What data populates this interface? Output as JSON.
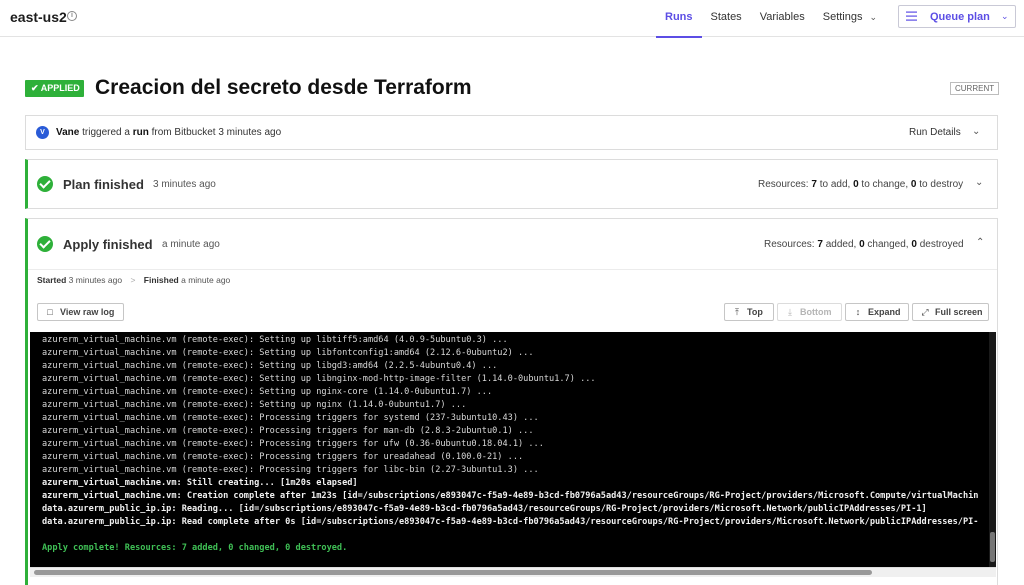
{
  "workspace": {
    "name": "east-us2"
  },
  "nav": {
    "items": [
      {
        "label": "Runs",
        "active": true
      },
      {
        "label": "States",
        "active": false
      },
      {
        "label": "Variables",
        "active": false
      },
      {
        "label": "Settings",
        "active": false
      }
    ],
    "queue_plan_label": "Queue plan"
  },
  "run": {
    "status_badge": "APPLIED",
    "title": "Creacion del secreto desde Terraform",
    "current_tag": "CURRENT",
    "trigger": {
      "avatar_letter": "V",
      "user": "Vane",
      "text_mid": "triggered a",
      "run_word": "run",
      "text_end": "from Bitbucket 3 minutes ago"
    },
    "run_details_label": "Run Details"
  },
  "plan": {
    "title": "Plan finished",
    "time": "3 minutes ago",
    "res_prefix": "Resources:",
    "add": "7",
    "add_label": "to add,",
    "change": "0",
    "change_label": "to change,",
    "destroy": "0",
    "destroy_label": "to destroy"
  },
  "apply": {
    "title": "Apply finished",
    "time": "a minute ago",
    "res_prefix": "Resources:",
    "added": "7",
    "added_label": "added,",
    "changed": "0",
    "changed_label": "changed,",
    "destroyed": "0",
    "destroyed_label": "destroyed",
    "started_label": "Started",
    "started_time": "3 minutes ago",
    "finished_label": "Finished",
    "finished_time": "a minute ago",
    "separator": ">",
    "buttons": {
      "view_raw_log": "View raw log",
      "top": "Top",
      "bottom": "Bottom",
      "expand": "Expand",
      "full_screen": "Full screen"
    }
  },
  "log_lines": [
    {
      "text": "azurerm_virtual_machine.vm (remote-exec): Setting up libtiff5:amd64 (4.0.9-5ubuntu0.3) ...",
      "style": "normal"
    },
    {
      "text": "azurerm_virtual_machine.vm (remote-exec): Setting up libfontconfig1:amd64 (2.12.6-0ubuntu2) ...",
      "style": "normal"
    },
    {
      "text": "azurerm_virtual_machine.vm (remote-exec): Setting up libgd3:amd64 (2.2.5-4ubuntu0.4) ...",
      "style": "normal"
    },
    {
      "text": "azurerm_virtual_machine.vm (remote-exec): Setting up libnginx-mod-http-image-filter (1.14.0-0ubuntu1.7) ...",
      "style": "normal"
    },
    {
      "text": "azurerm_virtual_machine.vm (remote-exec): Setting up nginx-core (1.14.0-0ubuntu1.7) ...",
      "style": "normal"
    },
    {
      "text": "azurerm_virtual_machine.vm (remote-exec): Setting up nginx (1.14.0-0ubuntu1.7) ...",
      "style": "normal"
    },
    {
      "text": "azurerm_virtual_machine.vm (remote-exec): Processing triggers for systemd (237-3ubuntu10.43) ...",
      "style": "normal"
    },
    {
      "text": "azurerm_virtual_machine.vm (remote-exec): Processing triggers for man-db (2.8.3-2ubuntu0.1) ...",
      "style": "normal"
    },
    {
      "text": "azurerm_virtual_machine.vm (remote-exec): Processing triggers for ufw (0.36-0ubuntu0.18.04.1) ...",
      "style": "normal"
    },
    {
      "text": "azurerm_virtual_machine.vm (remote-exec): Processing triggers for ureadahead (0.100.0-21) ...",
      "style": "normal"
    },
    {
      "text": "azurerm_virtual_machine.vm (remote-exec): Processing triggers for libc-bin (2.27-3ubuntu1.3) ...",
      "style": "normal"
    },
    {
      "text": "azurerm_virtual_machine.vm: Still creating... [1m20s elapsed]",
      "style": "bold"
    },
    {
      "text": "azurerm_virtual_machine.vm: Creation complete after 1m23s [id=/subscriptions/e893047c-f5a9-4e89-b3cd-fb0796a5ad43/resourceGroups/RG-Project/providers/Microsoft.Compute/virtualMachin",
      "style": "bold"
    },
    {
      "text": "data.azurerm_public_ip.ip: Reading... [id=/subscriptions/e893047c-f5a9-4e89-b3cd-fb0796a5ad43/resourceGroups/RG-Project/providers/Microsoft.Network/publicIPAddresses/PI-1]",
      "style": "bold"
    },
    {
      "text": "data.azurerm_public_ip.ip: Read complete after 0s [id=/subscriptions/e893047c-f5a9-4e89-b3cd-fb0796a5ad43/resourceGroups/RG-Project/providers/Microsoft.Network/publicIPAddresses/PI-",
      "style": "bold"
    },
    {
      "text": "",
      "style": "normal"
    },
    {
      "text": "Apply complete! Resources: 7 added, 0 changed, 0 destroyed.",
      "style": "success"
    }
  ],
  "colors": {
    "accent": "#5c4ee5",
    "success": "#2eb039",
    "terminal_bg": "#000000"
  }
}
